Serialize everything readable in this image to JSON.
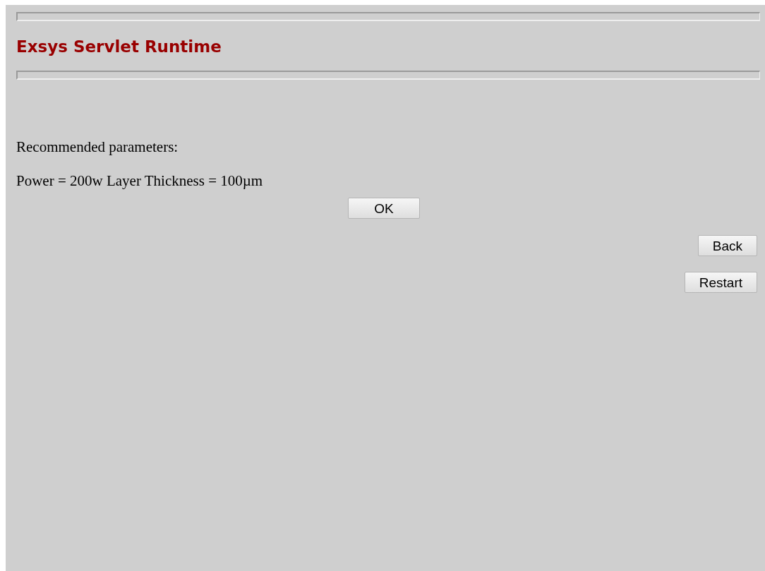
{
  "title": "Exsys Servlet Runtime",
  "paragraphs": [
    "Recommended parameters:",
    "Power = 200w Layer Thickness = 100µm"
  ],
  "ok_button": "OK",
  "nav_buttons": [
    "Back",
    "Restart"
  ]
}
